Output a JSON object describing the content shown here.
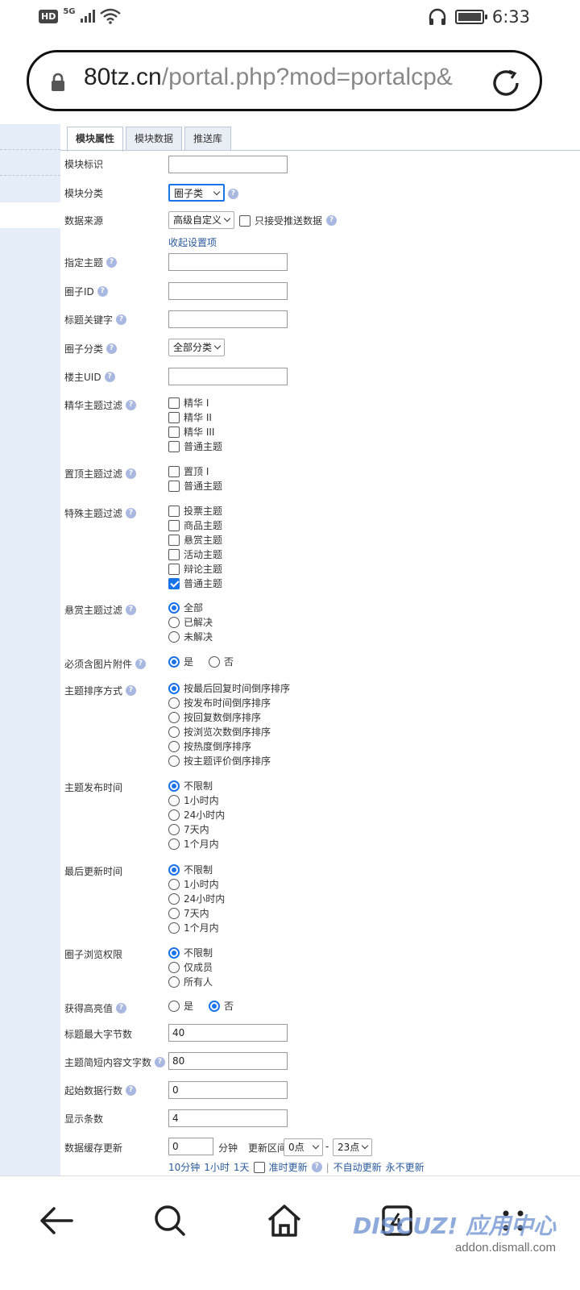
{
  "status": {
    "network": "5G",
    "hd": "HD",
    "time": "6:33"
  },
  "browser": {
    "url_host": "80tz.cn",
    "url_path": "/portal.php?mod=portalcp&"
  },
  "tabs": [
    "模块属性",
    "模块数据",
    "推送库"
  ],
  "fields": {
    "block_id": {
      "label": "模块标识",
      "value": ""
    },
    "block_category": {
      "label": "模块分类",
      "value": "圈子类"
    },
    "data_source": {
      "label": "数据来源",
      "value": "高级自定义",
      "push_only": "只接受推送数据",
      "collapse": "收起设置项"
    },
    "topic_id": {
      "label": "指定主题",
      "value": ""
    },
    "group_id": {
      "label": "圈子ID",
      "value": ""
    },
    "title_keyword": {
      "label": "标题关键字",
      "value": ""
    },
    "group_category": {
      "label": "圈子分类",
      "value": "全部分类"
    },
    "owner_uid": {
      "label": "楼主UID",
      "value": ""
    },
    "digest_filter": {
      "label": "精华主题过滤",
      "options": [
        "精华 I",
        "精华 II",
        "精华 III",
        "普通主题"
      ]
    },
    "sticky_filter": {
      "label": "置顶主题过滤",
      "options": [
        "置顶 I",
        "普通主题"
      ]
    },
    "special_filter": {
      "label": "特殊主题过滤",
      "options": [
        "投票主题",
        "商品主题",
        "悬赏主题",
        "活动主题",
        "辩论主题",
        "普通主题"
      ]
    },
    "reward_filter": {
      "label": "悬赏主题过滤",
      "options": [
        "全部",
        "已解决",
        "未解决"
      ]
    },
    "must_image": {
      "label": "必须含图片附件",
      "yes": "是",
      "no": "否"
    },
    "order": {
      "label": "主题排序方式",
      "options": [
        "按最后回复时间倒序排序",
        "按发布时间倒序排序",
        "按回复数倒序排序",
        "按浏览次数倒序排序",
        "按热度倒序排序",
        "按主题评价倒序排序"
      ]
    },
    "post_time": {
      "label": "主题发布时间",
      "options": [
        "不限制",
        "1小时内",
        "24小时内",
        "7天内",
        "1个月内"
      ]
    },
    "last_update": {
      "label": "最后更新时间",
      "options": [
        "不限制",
        "1小时内",
        "24小时内",
        "7天内",
        "1个月内"
      ]
    },
    "view_perm": {
      "label": "圈子浏览权限",
      "options": [
        "不限制",
        "仅成员",
        "所有人"
      ]
    },
    "highlight": {
      "label": "获得高亮值",
      "yes": "是",
      "no": "否"
    },
    "title_max": {
      "label": "标题最大字节数",
      "value": "40"
    },
    "summary_len": {
      "label": "主题简短内容文字数",
      "value": "80"
    },
    "start_row": {
      "label": "起始数据行数",
      "value": "0"
    },
    "show_count": {
      "label": "显示条数",
      "value": "4"
    },
    "cache": {
      "label": "数据缓存更新",
      "value": "0",
      "unit": "分钟",
      "range_label": "更新区间",
      "from": "0点",
      "sep": "-",
      "to": "23点",
      "quick": [
        "10分钟",
        "1小时",
        "1天"
      ],
      "ontime": "准时更新",
      "manual": "不自动更新",
      "never": "永不更新",
      "divider": "|"
    }
  },
  "watermark": {
    "logo": "DISCUZ! 应用中心",
    "site": "addon.dismall.com"
  }
}
